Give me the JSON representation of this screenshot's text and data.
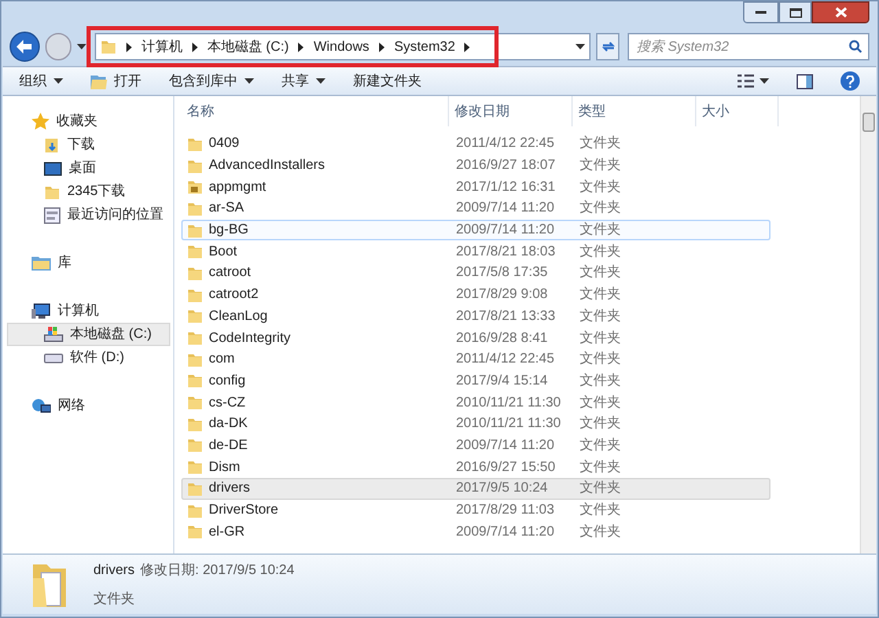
{
  "address_bar": {
    "highlighted": true,
    "crumbs": [
      "计算机",
      "本地磁盘 (C:)",
      "Windows",
      "System32"
    ]
  },
  "search": {
    "placeholder": "搜索 System32"
  },
  "toolbar": [
    {
      "label": "组织",
      "kind": "menu"
    },
    {
      "label": "打开",
      "kind": "icon"
    },
    {
      "label": "包含到库中",
      "kind": "menu"
    },
    {
      "label": "共享",
      "kind": "menu"
    },
    {
      "label": "新建文件夹",
      "kind": "plain"
    }
  ],
  "sidebar": {
    "groups": [
      {
        "label": "收藏夹",
        "kind": "star",
        "items": [
          {
            "label": "下载",
            "kind": "download",
            "selected": false
          },
          {
            "label": "桌面",
            "kind": "desktop",
            "selected": false
          },
          {
            "label": "2345下载",
            "kind": "folder",
            "selected": false
          },
          {
            "label": "最近访问的位置",
            "kind": "recent",
            "selected": false
          }
        ]
      },
      {
        "label": "库",
        "kind": "library"
      },
      {
        "label": "计算机",
        "kind": "computer",
        "items": [
          {
            "label": "本地磁盘 (C:)",
            "kind": "windrive",
            "selected": true
          },
          {
            "label": "软件 (D:)",
            "kind": "drive",
            "selected": false
          }
        ]
      },
      {
        "label": "网络",
        "kind": "network"
      }
    ]
  },
  "table": {
    "columns": [
      "名称",
      "修改日期",
      "类型",
      "大小"
    ],
    "rows": [
      {
        "name": "0409",
        "date": "2011/4/12 22:45",
        "type": "文件夹",
        "locked": false,
        "hovered": false,
        "selected": false
      },
      {
        "name": "AdvancedInstallers",
        "date": "2016/9/27 18:07",
        "type": "文件夹",
        "locked": false,
        "hovered": false,
        "selected": false
      },
      {
        "name": "appmgmt",
        "date": "2017/1/12 16:31",
        "type": "文件夹",
        "locked": true,
        "hovered": false,
        "selected": false
      },
      {
        "name": "ar-SA",
        "date": "2009/7/14 11:20",
        "type": "文件夹",
        "locked": false,
        "hovered": false,
        "selected": false
      },
      {
        "name": "bg-BG",
        "date": "2009/7/14 11:20",
        "type": "文件夹",
        "locked": false,
        "hovered": true,
        "selected": false
      },
      {
        "name": "Boot",
        "date": "2017/8/21 18:03",
        "type": "文件夹",
        "locked": false,
        "hovered": false,
        "selected": false
      },
      {
        "name": "catroot",
        "date": "2017/5/8 17:35",
        "type": "文件夹",
        "locked": false,
        "hovered": false,
        "selected": false
      },
      {
        "name": "catroot2",
        "date": "2017/8/29 9:08",
        "type": "文件夹",
        "locked": false,
        "hovered": false,
        "selected": false
      },
      {
        "name": "CleanLog",
        "date": "2017/8/21 13:33",
        "type": "文件夹",
        "locked": false,
        "hovered": false,
        "selected": false
      },
      {
        "name": "CodeIntegrity",
        "date": "2016/9/28 8:41",
        "type": "文件夹",
        "locked": false,
        "hovered": false,
        "selected": false
      },
      {
        "name": "com",
        "date": "2011/4/12 22:45",
        "type": "文件夹",
        "locked": false,
        "hovered": false,
        "selected": false
      },
      {
        "name": "config",
        "date": "2017/9/4 15:14",
        "type": "文件夹",
        "locked": false,
        "hovered": false,
        "selected": false
      },
      {
        "name": "cs-CZ",
        "date": "2010/11/21 11:30",
        "type": "文件夹",
        "locked": false,
        "hovered": false,
        "selected": false
      },
      {
        "name": "da-DK",
        "date": "2010/11/21 11:30",
        "type": "文件夹",
        "locked": false,
        "hovered": false,
        "selected": false
      },
      {
        "name": "de-DE",
        "date": "2009/7/14 11:20",
        "type": "文件夹",
        "locked": false,
        "hovered": false,
        "selected": false
      },
      {
        "name": "Dism",
        "date": "2016/9/27 15:50",
        "type": "文件夹",
        "locked": false,
        "hovered": false,
        "selected": false
      },
      {
        "name": "drivers",
        "date": "2017/9/5 10:24",
        "type": "文件夹",
        "locked": false,
        "hovered": false,
        "selected": true
      },
      {
        "name": "DriverStore",
        "date": "2017/8/29 11:03",
        "type": "文件夹",
        "locked": false,
        "hovered": false,
        "selected": false
      },
      {
        "name": "el-GR",
        "date": "2009/7/14 11:20",
        "type": "文件夹",
        "locked": false,
        "hovered": false,
        "selected": false
      }
    ]
  },
  "details": {
    "name": "drivers",
    "date_label": "修改日期:",
    "date": "2017/9/5 10:24",
    "type": "文件夹"
  }
}
